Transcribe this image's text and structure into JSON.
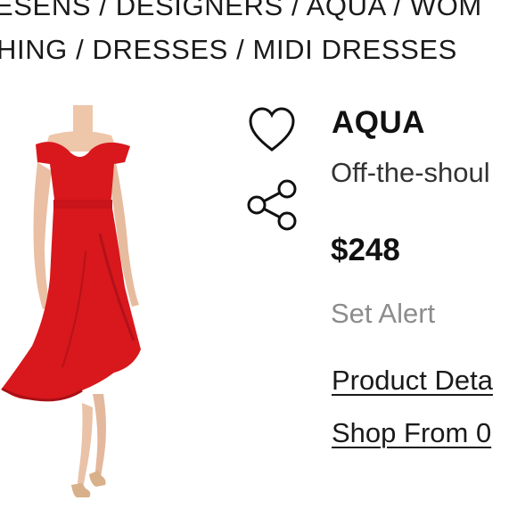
{
  "breadcrumb": {
    "line1": "ESENS / DESIGNERS / AQUA / WOM",
    "line2": "HING / DRESSES / MIDI DRESSES"
  },
  "product": {
    "image_description_color": "#d8181c",
    "brand": "AQUA",
    "name": "Off-the-shoul",
    "price": "$248",
    "set_alert_label": "Set Alert"
  },
  "actions": {
    "like_icon": "heart-icon",
    "share_icon": "share-icon"
  },
  "links": {
    "product_details": "Product Deta",
    "shop_from": "Shop From 0"
  }
}
